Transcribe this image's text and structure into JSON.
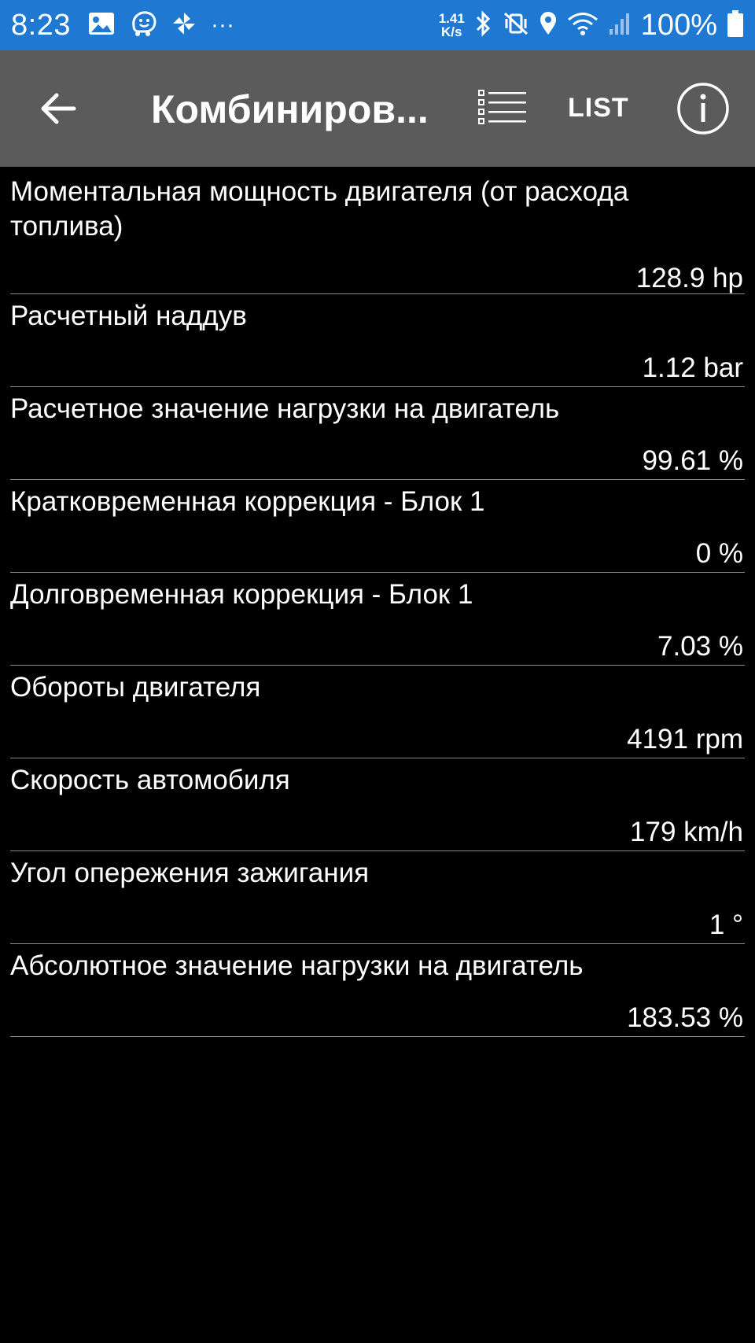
{
  "status_bar": {
    "time": "8:23",
    "left_icons": [
      "gallery-icon",
      "waze-icon",
      "pinwheel-icon",
      "more-dots-icon"
    ],
    "more": "···",
    "net_speed_value": "1.41",
    "net_speed_unit": "K/s",
    "right_icons": [
      "bluetooth-icon",
      "vibrate-mute-icon",
      "location-icon",
      "wifi-icon",
      "cell-signal-icon",
      "battery-icon"
    ],
    "battery": "100%",
    "color": "#1f78d1"
  },
  "app_bar": {
    "title": "Комбиниров...",
    "list_label": "LIST",
    "color": "#5b5b5b",
    "icons": [
      "back-arrow-icon",
      "list-view-icon",
      "info-icon"
    ]
  },
  "readings": [
    {
      "label": "Моментальная мощность двигателя (от расхода топлива)",
      "value": "128.9 hp"
    },
    {
      "label": "Расчетный наддув",
      "value": "1.12 bar"
    },
    {
      "label": "Расчетное значение нагрузки на двигатель",
      "value": "99.61 %"
    },
    {
      "label": "Кратковременная коррекция - Блок 1",
      "value": "0 %"
    },
    {
      "label": "Долговременная коррекция - Блок 1",
      "value": "7.03 %"
    },
    {
      "label": "Обороты двигателя",
      "value": "4191 rpm"
    },
    {
      "label": "Скорость автомобиля",
      "value": "179 km/h"
    },
    {
      "label": "Угол опережения зажигания",
      "value": "1 °"
    },
    {
      "label": "Абсолютное значение нагрузки на двигатель",
      "value": "183.53 %"
    }
  ]
}
